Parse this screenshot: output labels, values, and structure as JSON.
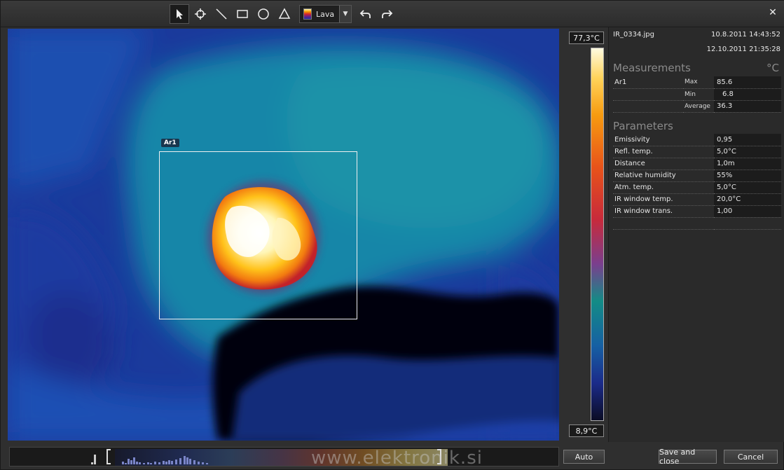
{
  "toolbar": {
    "tools": [
      "pointer-icon",
      "spot-crosshair-icon",
      "line-icon",
      "rectangle-icon",
      "circle-icon",
      "triangle-icon"
    ],
    "palette_label": "Lava",
    "undo_icon": "undo-icon",
    "redo_icon": "redo-icon",
    "close_label": "✕"
  },
  "image": {
    "roi_label": "Ar1"
  },
  "scale": {
    "max": "77,3°C",
    "min": "8,9°C"
  },
  "info": {
    "file_name": "IR_0334.jpg",
    "date1": "10.8.2011 14:43:52",
    "date2": "12.10.2011 21:35:28"
  },
  "measurements": {
    "title": "Measurements",
    "unit": "°C",
    "area": "Ar1",
    "rows": [
      {
        "label": "Max",
        "value": "85.6"
      },
      {
        "label": "Min",
        "value": "6.8"
      },
      {
        "label": "Average",
        "value": "36.3"
      }
    ]
  },
  "parameters": {
    "title": "Parameters",
    "rows": [
      {
        "label": "Emissivity",
        "value": "0,95"
      },
      {
        "label": "Refl. temp.",
        "value": "5,0°C"
      },
      {
        "label": "Distance",
        "value": "1,0m"
      },
      {
        "label": "Relative humidity",
        "value": "55%"
      },
      {
        "label": "Atm. temp.",
        "value": "5,0°C"
      },
      {
        "label": "IR window temp.",
        "value": "20,0°C"
      },
      {
        "label": "IR window trans.",
        "value": "1,00"
      }
    ]
  },
  "bottom": {
    "watermark": "www.elektronik.si",
    "auto_label": "Auto",
    "save_label": "Save and close",
    "cancel_label": "Cancel"
  }
}
